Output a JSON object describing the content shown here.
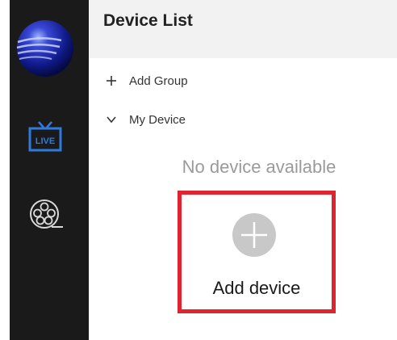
{
  "header": {
    "title": "Device List"
  },
  "sidebar": {
    "items": [
      {
        "icon": "globe-logo-icon"
      },
      {
        "icon": "live-tv-icon",
        "label": "LIVE",
        "active": true
      },
      {
        "icon": "film-reel-icon"
      }
    ]
  },
  "tree": {
    "add_group_label": "Add Group",
    "my_device_label": "My Device"
  },
  "empty_state": {
    "message": "No device available",
    "add_button_label": "Add device"
  },
  "colors": {
    "sidebar_bg": "#1a1a1a",
    "header_bg": "#f2f2f2",
    "accent_blue": "#2e7bd9",
    "highlight_red": "#e0242f",
    "muted_text": "#9a9a9a"
  }
}
